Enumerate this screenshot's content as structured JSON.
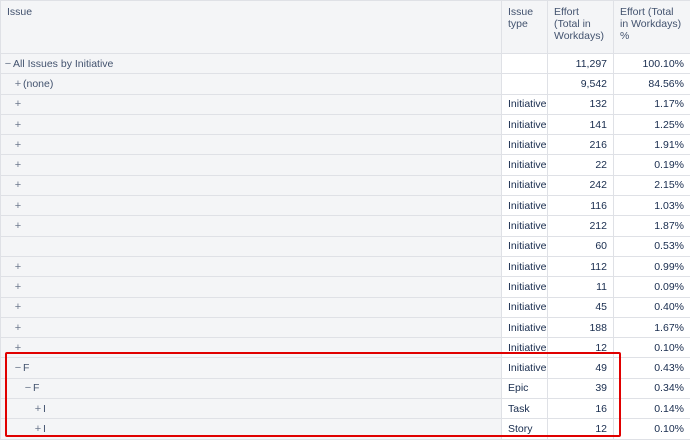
{
  "columns": {
    "issue": "Issue",
    "type": "Issue type",
    "effort": "Effort (Total in Workdays)",
    "effort_pct": "Effort (Total in Workdays) %"
  },
  "rows": [
    {
      "toggle": "−",
      "indent": 0,
      "label": "All Issues by Initiative",
      "type": "",
      "effort": "11,297",
      "pct": "100.10%"
    },
    {
      "toggle": "+",
      "indent": 1,
      "label": "(none)",
      "type": "",
      "effort": "9,542",
      "pct": "84.56%"
    },
    {
      "toggle": "+",
      "indent": 1,
      "label": "",
      "type": "Initiative",
      "effort": "132",
      "pct": "1.17%"
    },
    {
      "toggle": "+",
      "indent": 1,
      "label": "",
      "type": "Initiative",
      "effort": "141",
      "pct": "1.25%"
    },
    {
      "toggle": "+",
      "indent": 1,
      "label": "",
      "type": "Initiative",
      "effort": "216",
      "pct": "1.91%"
    },
    {
      "toggle": "+",
      "indent": 1,
      "label": "",
      "type": "Initiative",
      "effort": "22",
      "pct": "0.19%"
    },
    {
      "toggle": "+",
      "indent": 1,
      "label": "",
      "type": "Initiative",
      "effort": "242",
      "pct": "2.15%"
    },
    {
      "toggle": "+",
      "indent": 1,
      "label": "",
      "type": "Initiative",
      "effort": "116",
      "pct": "1.03%"
    },
    {
      "toggle": "+",
      "indent": 1,
      "label": "",
      "type": "Initiative",
      "effort": "212",
      "pct": "1.87%"
    },
    {
      "toggle": "",
      "indent": 1,
      "label": "",
      "type": "Initiative",
      "effort": "60",
      "pct": "0.53%"
    },
    {
      "toggle": "+",
      "indent": 1,
      "label": "",
      "type": "Initiative",
      "effort": "112",
      "pct": "0.99%"
    },
    {
      "toggle": "+",
      "indent": 1,
      "label": "",
      "type": "Initiative",
      "effort": "11",
      "pct": "0.09%"
    },
    {
      "toggle": "+",
      "indent": 1,
      "label": "",
      "type": "Initiative",
      "effort": "45",
      "pct": "0.40%"
    },
    {
      "toggle": "+",
      "indent": 1,
      "label": "",
      "type": "Initiative",
      "effort": "188",
      "pct": "1.67%"
    },
    {
      "toggle": "+",
      "indent": 1,
      "label": "",
      "type": "Initiative",
      "effort": "12",
      "pct": "0.10%"
    },
    {
      "toggle": "−",
      "indent": 1,
      "label": "F",
      "type": "Initiative",
      "effort": "49",
      "pct": "0.43%"
    },
    {
      "toggle": "−",
      "indent": 2,
      "label": "F",
      "type": "Epic",
      "effort": "39",
      "pct": "0.34%"
    },
    {
      "toggle": "+",
      "indent": 3,
      "label": "I",
      "type": "Task",
      "effort": "16",
      "pct": "0.14%"
    },
    {
      "toggle": "+",
      "indent": 3,
      "label": "I",
      "type": "Story",
      "effort": "12",
      "pct": "0.10%"
    }
  ]
}
